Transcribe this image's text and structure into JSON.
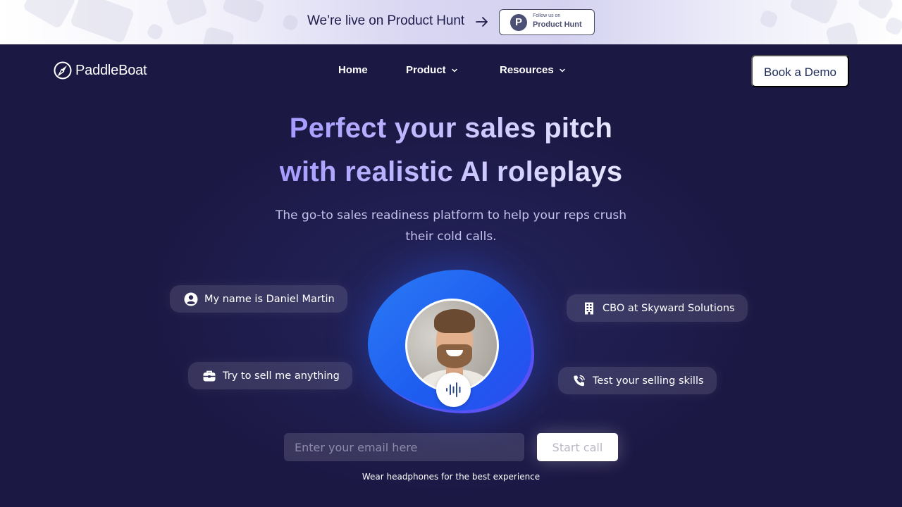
{
  "announcement": {
    "text": "We’re live on Product Hunt",
    "arrow_icon": "arrow-right-icon",
    "badge": {
      "logo_letter": "P",
      "small_text": "Follow us on",
      "big_text": "Product Hunt"
    }
  },
  "nav": {
    "brand": "PaddleBoat",
    "links": [
      {
        "label": "Home",
        "has_dropdown": false
      },
      {
        "label": "Product",
        "has_dropdown": true
      },
      {
        "label": "Resources",
        "has_dropdown": true
      }
    ],
    "cta": "Book a Demo"
  },
  "hero": {
    "headline_line1": "Perfect your sales pitch",
    "headline_line2": "with realistic AI roleplays",
    "subtitle": "The go-to sales readiness platform to help your reps crush their cold calls.",
    "persona_pills": [
      {
        "icon": "user-circle-icon",
        "text": "My name is Daniel Martin"
      },
      {
        "icon": "building-icon",
        "text": "CBO at Skyward Solutions"
      },
      {
        "icon": "briefcase-icon",
        "text": "Try to sell me anything"
      },
      {
        "icon": "phone-call-icon",
        "text": "Test your selling skills"
      }
    ],
    "avatar_icon": "voice-wave-icon"
  },
  "form": {
    "email_placeholder": "Enter your email here",
    "email_value": "",
    "submit_label": "Start call",
    "hint": "Wear headphones for the best experience"
  },
  "colors": {
    "background": "#1c1844",
    "headline_gradient_start": "#a69bff",
    "headline_gradient_end": "#e8e6ff",
    "blob_blue": "#1e5df0",
    "cta_text": "#1d2b5a"
  }
}
